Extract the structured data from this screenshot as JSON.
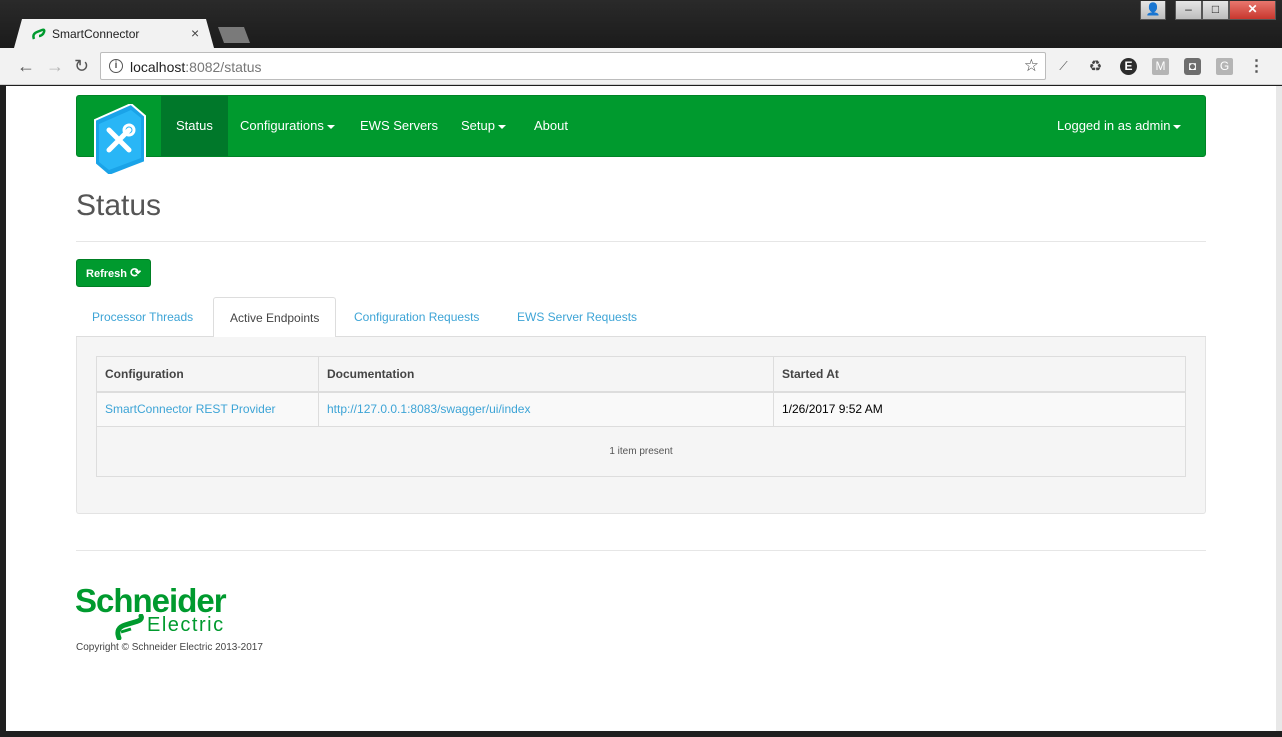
{
  "browser": {
    "tab_title": "SmartConnector",
    "tab_close": "×",
    "url_host": "localhost",
    "url_rest": ":8082/status",
    "info_glyph": "i",
    "window_controls": {
      "user": "👤",
      "minimize": "–",
      "maximize": "□",
      "close": "✕"
    },
    "extensions": [
      {
        "name": "ext-pick-icon",
        "glyph": "⟋"
      },
      {
        "name": "recycle-icon",
        "glyph": "♻"
      },
      {
        "name": "ext-e-icon",
        "glyph": "E"
      },
      {
        "name": "ext-m-icon",
        "glyph": "M"
      },
      {
        "name": "ext-pocket-icon",
        "glyph": "◘"
      },
      {
        "name": "ext-g-icon",
        "glyph": "G"
      }
    ],
    "menu_glyph": "⋮"
  },
  "navbar": {
    "items": [
      "Status",
      "Configurations",
      "EWS Servers",
      "Setup",
      "About"
    ],
    "user": "Logged in as admin"
  },
  "page": {
    "title": "Status",
    "refresh_label": "Refresh",
    "refresh_glyph": "⟳"
  },
  "tabs": [
    "Processor Threads",
    "Active Endpoints",
    "Configuration Requests",
    "EWS Server Requests"
  ],
  "table": {
    "columns": [
      "Configuration",
      "Documentation",
      "Started At"
    ],
    "rows": [
      [
        "SmartConnector REST Provider",
        "http://127.0.0.1:8083/swagger/ui/index",
        "1/26/2017 9:52 AM"
      ]
    ],
    "footer": "1 item present"
  },
  "footer": {
    "brand_line1": "Schneider",
    "brand_line2": "Electric",
    "copyright": "Copyright © Schneider Electric 2013-2017"
  },
  "colors": {
    "brand_green": "#009a2e",
    "link_blue": "#3da4d6",
    "active_nav": "#00782a"
  }
}
